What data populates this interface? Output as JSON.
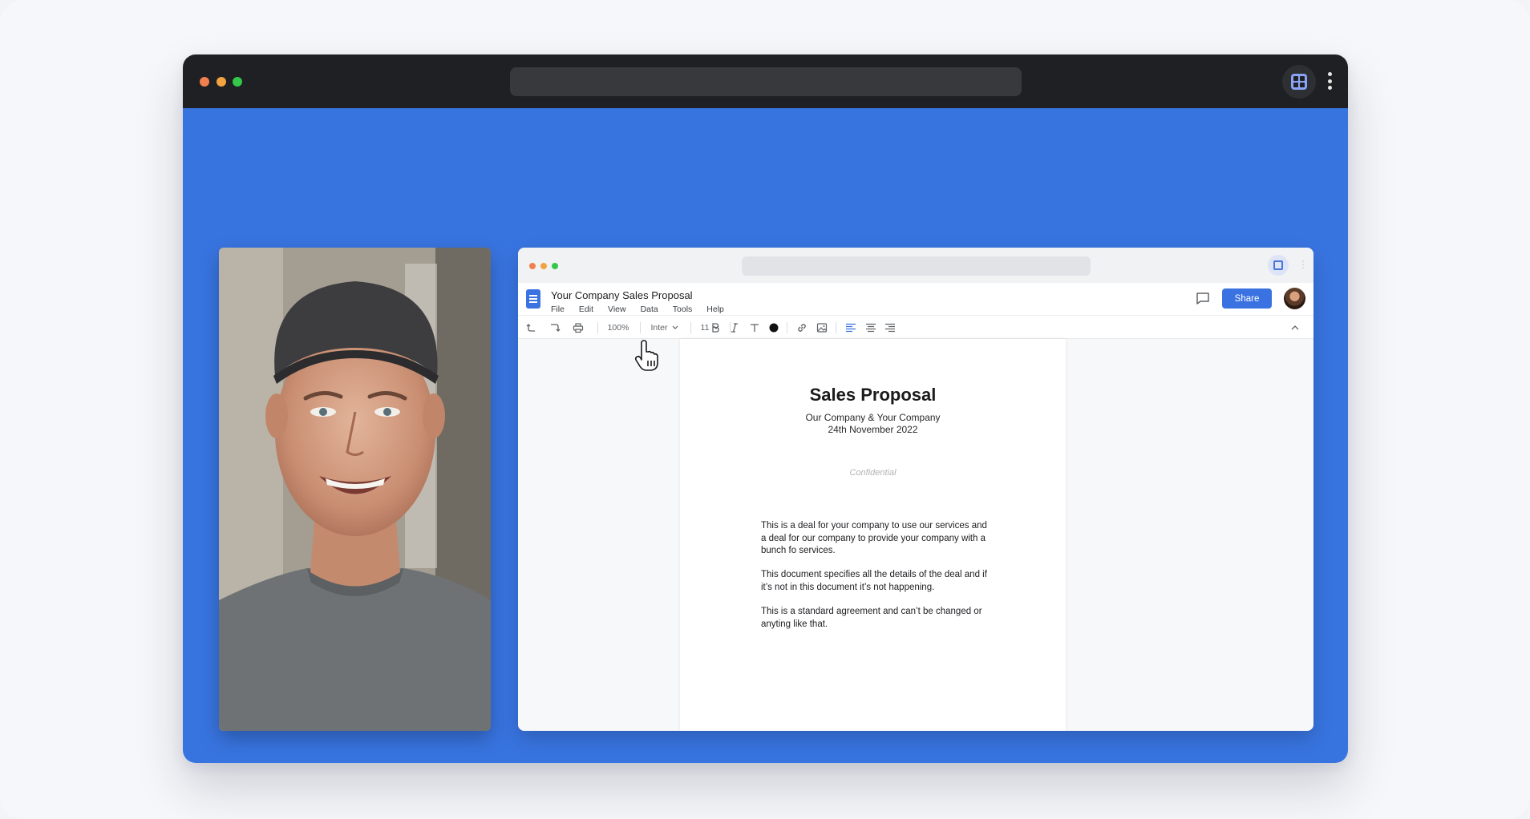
{
  "doc_app": {
    "document_title": "Your Company Sales Proposal",
    "menu": [
      "File",
      "Edit",
      "View",
      "Data",
      "Tools",
      "Help"
    ],
    "share_label": "Share",
    "toolbar": {
      "zoom": "100%",
      "font": "Inter",
      "font_size": "11"
    },
    "page": {
      "title": "Sales Proposal",
      "subtitle": "Our Company & Your Company",
      "date": "24th November 2022",
      "confidential": "Confidential",
      "paragraphs": [
        "This is a deal for your company to use our services and a deal for our company to provide your company with a bunch fo services.",
        "This document specifies all the details of the deal and if it’s not in this document it’s not happening.",
        "This is a standard agreement and can’t be changed or anyting like that."
      ]
    }
  },
  "colors": {
    "stage_background": "#3874e0",
    "accent": "#3a72e1",
    "titlebar": "#1f2023"
  }
}
